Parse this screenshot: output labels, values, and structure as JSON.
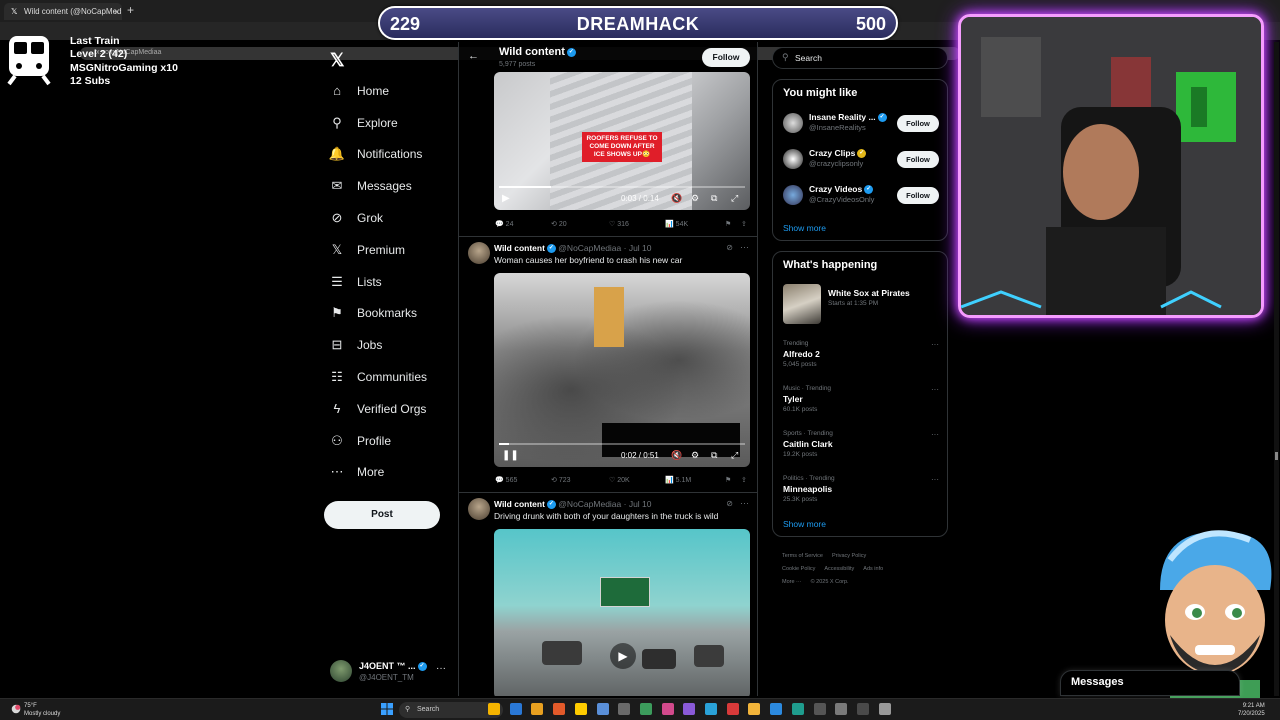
{
  "browser": {
    "tab_title": "Wild content (@NoCapMedia",
    "url": "x.com/NoCapMediaa"
  },
  "overlay": {
    "train_title": "Last Train",
    "train_level": "Level 2  (42)",
    "train_gift": "MSGNitroGaming x10",
    "train_subs": "12 Subs"
  },
  "banner": {
    "left_value": "229",
    "title": "DREAMHACK",
    "right_value": "500",
    "progress_fraction": 0.458
  },
  "nav": {
    "items": [
      {
        "label": "Home",
        "icon": "home-icon",
        "glyph": "⌂"
      },
      {
        "label": "Explore",
        "icon": "search-icon",
        "glyph": "⚲"
      },
      {
        "label": "Notifications",
        "icon": "bell-icon",
        "glyph": "🔔"
      },
      {
        "label": "Messages",
        "icon": "mail-icon",
        "glyph": "✉"
      },
      {
        "label": "Grok",
        "icon": "grok-icon",
        "glyph": "⊘"
      },
      {
        "label": "Premium",
        "icon": "x-premium-icon",
        "glyph": "𝕏"
      },
      {
        "label": "Lists",
        "icon": "list-icon",
        "glyph": "☰"
      },
      {
        "label": "Bookmarks",
        "icon": "bookmark-icon",
        "glyph": "⚑"
      },
      {
        "label": "Jobs",
        "icon": "briefcase-icon",
        "glyph": "⊟"
      },
      {
        "label": "Communities",
        "icon": "people-icon",
        "glyph": "☷"
      },
      {
        "label": "Verified Orgs",
        "icon": "lightning-icon",
        "glyph": "ϟ"
      },
      {
        "label": "Profile",
        "icon": "person-icon",
        "glyph": "⚇"
      },
      {
        "label": "More",
        "icon": "more-circle-icon",
        "glyph": "⋯"
      }
    ],
    "post_label": "Post",
    "account_name": "J4OENT ™ ...",
    "account_handle": "@J4OENT_TM"
  },
  "feed": {
    "title": "Wild content",
    "post_count": "5,977 posts",
    "follow_label": "Follow",
    "video1": {
      "overlay_text": "ROOFERS REFUSE TO COME DOWN AFTER ICE SHOWS UP😳",
      "time": "0:03 / 0:14",
      "progress": 0.21
    },
    "actions1": {
      "replies": "24",
      "reposts": "20",
      "likes": "316",
      "views": "54K"
    },
    "tweet2": {
      "name": "Wild content",
      "meta": "@NoCapMediaa · Jul 10",
      "text": "Woman causes her boyfriend to crash his new car",
      "time": "0:02 / 0:51",
      "progress": 0.04,
      "replies": "565",
      "reposts": "723",
      "likes": "20K",
      "views": "5.1M"
    },
    "tweet3": {
      "name": "Wild content",
      "meta": "@NoCapMediaa · Jul 10",
      "text": "Driving drunk with both of your daughters in the truck is wild"
    }
  },
  "right": {
    "search_placeholder": "Search",
    "you_might_like": "You might like",
    "suggestions": [
      {
        "name": "Insane Reality ...",
        "handle": "@InsaneRealitys",
        "follow": "Follow",
        "badge": "blue"
      },
      {
        "name": "Crazy Clips",
        "handle": "@crazyclipsonly",
        "follow": "Follow",
        "badge": "gold"
      },
      {
        "name": "Crazy Videos",
        "handle": "@CrazyVideosOnly",
        "follow": "Follow",
        "badge": "blue"
      }
    ],
    "show_more": "Show more",
    "whats_happening": "What's happening",
    "event": {
      "title": "White Sox at Pirates",
      "sub": "Starts at 1:35 PM"
    },
    "trends": [
      {
        "cat": "Trending",
        "name": "Alfredo 2",
        "posts": "5,045 posts"
      },
      {
        "cat": "Music · Trending",
        "name": "Tyler",
        "posts": "60.1K posts"
      },
      {
        "cat": "Sports · Trending",
        "name": "Caitlin Clark",
        "posts": "19.2K posts"
      },
      {
        "cat": "Politics · Trending",
        "name": "Minneapolis",
        "posts": "25.3K posts"
      }
    ],
    "show_more2": "Show more",
    "footer": {
      "terms": "Terms of Service",
      "privacy": "Privacy Policy",
      "cookie": "Cookie Policy",
      "access": "Accessibility",
      "ads": "Ads info",
      "more": "More ···",
      "copy": "© 2025 X Corp."
    }
  },
  "messages_dock": "Messages",
  "taskbar": {
    "weather_temp": "75°F",
    "weather_desc": "Mostly cloudy",
    "search_label": "Search",
    "time": "9:21 AM",
    "date": "7/20/2025"
  },
  "colors": {
    "accent": "#1d9bf0",
    "banner_border": "#ffffff",
    "webcam_glow": "#d552ff"
  }
}
